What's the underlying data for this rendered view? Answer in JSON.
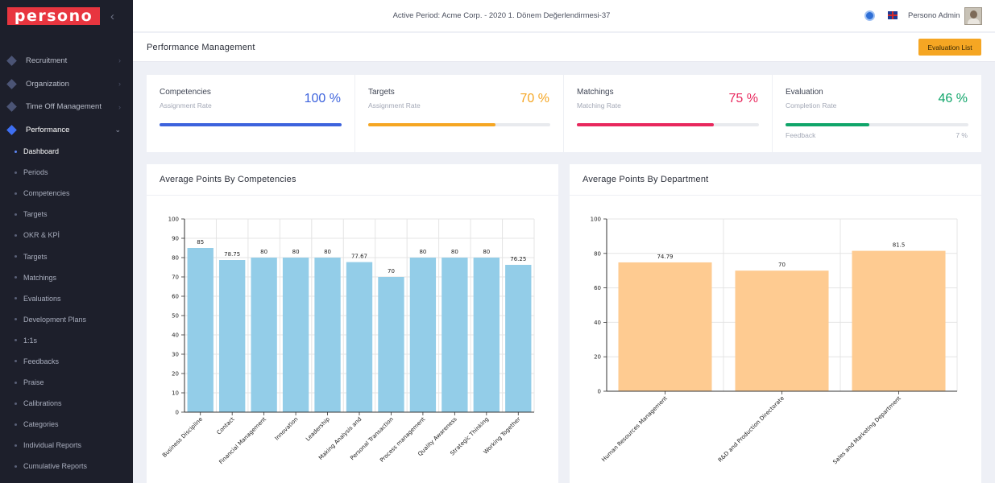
{
  "brand": {
    "logo_text": "persono"
  },
  "topbar": {
    "active_period": "Active Period: Acme Corp. - 2020 1. Dönem Değerlendirmesi-37",
    "user_name": "Persono Admin"
  },
  "sidebar": {
    "items": [
      {
        "label": "Recruitment",
        "icon": "diamond-icon"
      },
      {
        "label": "Organization",
        "icon": "diamond-icon"
      },
      {
        "label": "Time Off Management",
        "icon": "diamond-icon"
      },
      {
        "label": "Performance",
        "icon": "diamond-icon"
      }
    ],
    "sub_items": [
      {
        "label": "Dashboard"
      },
      {
        "label": "Periods"
      },
      {
        "label": "Competencies"
      },
      {
        "label": "Targets"
      },
      {
        "label": "OKR & KPİ"
      },
      {
        "label": "Targets"
      },
      {
        "label": "Matchings"
      },
      {
        "label": "Evaluations"
      },
      {
        "label": "Development Plans"
      },
      {
        "label": "1:1s"
      },
      {
        "label": "Feedbacks"
      },
      {
        "label": "Praise"
      },
      {
        "label": "Calibrations"
      },
      {
        "label": "Categories"
      },
      {
        "label": "Individual Reports"
      },
      {
        "label": "Cumulative Reports"
      }
    ]
  },
  "page": {
    "title": "Performance Management",
    "evaluation_list_button": "Evaluation List"
  },
  "stats": [
    {
      "title": "Competencies",
      "subtitle": "Assignment Rate",
      "value": "100 %",
      "percent": 100,
      "color": "#3d63dd"
    },
    {
      "title": "Targets",
      "subtitle": "Assignment Rate",
      "value": "70 %",
      "percent": 70,
      "color": "#f5a623"
    },
    {
      "title": "Matchings",
      "subtitle": "Matching Rate",
      "value": "75 %",
      "percent": 75,
      "color": "#e8285d"
    },
    {
      "title": "Evaluation",
      "subtitle": "Completion Rate",
      "value": "46 %",
      "percent": 46,
      "color": "#10a56a",
      "feedback_label": "Feedback",
      "feedback_value": "7 %"
    }
  ],
  "charts": {
    "competencies_title": "Average Points By Competencies",
    "department_title": "Average Points By Department"
  },
  "chart_data": [
    {
      "type": "bar",
      "title": "Average Points By Competencies",
      "categories": [
        "Business Discipline",
        "Contact",
        "Financial Management",
        "Innovation",
        "Leadership",
        "Making Analysis and",
        "Personal Transaction",
        "Process management",
        "Quality Awareness",
        "Strategic Thinking",
        "Working Together"
      ],
      "values": [
        85,
        78.75,
        80,
        80,
        80,
        77.67,
        70,
        80,
        80,
        80,
        76.25
      ],
      "value_labels": [
        "85",
        "78.75",
        "80",
        "80",
        "80",
        "77.67",
        "70",
        "80",
        "80",
        "80",
        "76.25"
      ],
      "yticks": [
        0,
        10,
        20,
        30,
        40,
        50,
        60,
        70,
        80,
        90,
        100
      ],
      "ylim": [
        0,
        100
      ],
      "grid": true,
      "color": "#93cde8"
    },
    {
      "type": "bar",
      "title": "Average Points By Department",
      "categories": [
        "Human Resources Management",
        "R&D and Production Directorate",
        "Sales and Marketing Department"
      ],
      "values": [
        74.79,
        70,
        81.5
      ],
      "value_labels": [
        "74.79",
        "70",
        "81.5"
      ],
      "yticks": [
        0,
        20,
        40,
        60,
        80,
        100
      ],
      "ylim": [
        0,
        100
      ],
      "grid": true,
      "color": "#fecb91"
    }
  ]
}
